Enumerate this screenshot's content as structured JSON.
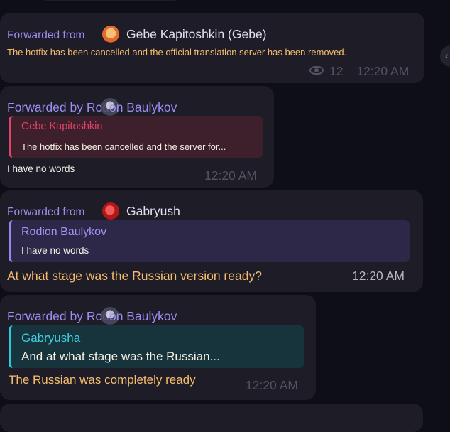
{
  "messages": [
    {
      "forward_prefix": "Forwarded from",
      "sender": "Gebe Kapitoshkin (Gebe)",
      "text": "The hotfix has been cancelled and the official translation server has been removed.",
      "views": "12",
      "time": "12:20 AM"
    },
    {
      "forward_prefix": "Forwarded by",
      "sender_a": "Rod",
      "sender_b": "on Baulykov",
      "reply": {
        "name": "Gebe Kapitoshkin",
        "text": "The hotfix has been cancelled and the server for...",
        "accent": "#e2426a"
      },
      "text": "I have no words",
      "time": "12:20 AM"
    },
    {
      "forward_prefix": "Forwarded from",
      "sender": "Gabryush",
      "reply": {
        "name": "Rodion Baulykov",
        "text": "I have no words",
        "accent": "#9b84ee"
      },
      "text": "At what stage was the Russian version ready?",
      "time": "12:20 AM"
    },
    {
      "forward_prefix": "Forwarded by",
      "sender_a": "Rod",
      "sender_b": "on Baulykov",
      "reply": {
        "name": "Gabryusha",
        "text": "And at what stage was the Russian...",
        "accent": "#2ac9e0"
      },
      "text": "The Russian was completely ready",
      "time": "12:20 AM"
    }
  ],
  "icons": {
    "views": "eye-icon",
    "scroll": "chevron-icon"
  },
  "colors": {
    "background": "#0e0e16",
    "bubble": "#1d1c27",
    "link": "#9a8ff0",
    "orange_text": "#f6bd6e"
  }
}
